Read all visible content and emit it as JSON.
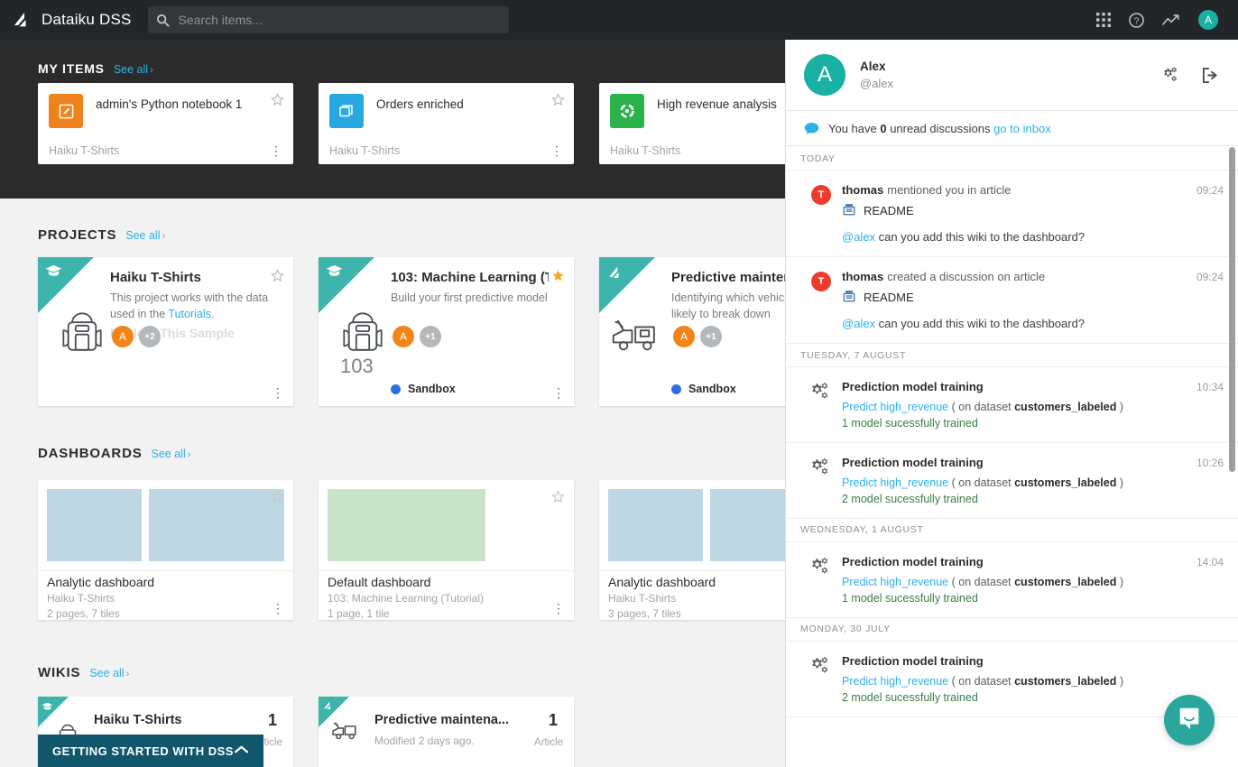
{
  "navbar": {
    "brand": "Dataiku DSS",
    "search_placeholder": "Search items...",
    "search_value": "",
    "icons": [
      "apps-grid-icon",
      "help-circle-icon",
      "trending-up-icon"
    ],
    "avatar_initial": "A"
  },
  "my_items": {
    "title": "MY ITEMS",
    "see_all": "See all",
    "chevron": "›",
    "cards": [
      {
        "name": "admin's Python notebook 1",
        "project": "Haiku T-Shirts",
        "icon": "notebook-edit-icon",
        "color": "#f0821e"
      },
      {
        "name": "Orders enriched",
        "project": "Haiku T-Shirts",
        "icon": "dataset-folder-icon",
        "color": "#28a8e0"
      },
      {
        "name": "High revenue analysis",
        "project": "Haiku T-Shirts",
        "icon": "analysis-circle-icon",
        "color": "#2ab24b"
      }
    ]
  },
  "projects": {
    "title": "PROJECTS",
    "see_all": "See all",
    "chevron": "›",
    "cards": [
      {
        "title": "Haiku T-Shirts",
        "desc_prefix": "This project works with the data used in the ",
        "desc_link": "Tutorials",
        "desc_suffix": ".",
        "ghost_text": "Explore This Sample",
        "number": "",
        "avatars": [
          {
            "label": "A",
            "type": "user"
          },
          {
            "label": "+2",
            "type": "more"
          }
        ],
        "status": "",
        "status_color": "",
        "starred": false,
        "bag_icon": "backpack-icon"
      },
      {
        "title": "103: Machine Learning (T...",
        "desc_prefix": "Build your first predictive model",
        "desc_link": "",
        "desc_suffix": "",
        "ghost_text": "",
        "number": "103",
        "avatars": [
          {
            "label": "A",
            "type": "user"
          },
          {
            "label": "+1",
            "type": "more"
          }
        ],
        "status": "Sandbox",
        "status_color": "#2f6fe0",
        "starred": true,
        "bag_icon": "backpack-icon"
      },
      {
        "title": "Predictive maintenance",
        "desc_prefix": "Identifying which vehicles are likely to break down",
        "desc_link": "",
        "desc_suffix": "",
        "ghost_text": "",
        "number": "",
        "avatars": [
          {
            "label": "A",
            "type": "user"
          },
          {
            "label": "+1",
            "type": "more"
          }
        ],
        "status": "Sandbox",
        "status_color": "#2f6fe0",
        "starred": false,
        "bag_icon": "tow-truck-icon"
      }
    ]
  },
  "dashboards": {
    "title": "DASHBOARDS",
    "see_all": "See all",
    "chevron": "›",
    "cards": [
      {
        "name": "Analytic dashboard",
        "project": "Haiku T-Shirts",
        "meta": "2 pages, 7 tiles",
        "thumb": "blue-two-tile"
      },
      {
        "name": "Default dashboard",
        "project": "103: Machine Learning (Tutorial)",
        "meta": "1 page, 1 tile",
        "thumb": "green-one-tile"
      },
      {
        "name": "Analytic dashboard",
        "project": "Haiku T-Shirts",
        "meta": "3 pages, 7 tiles",
        "thumb": "blue-two-tile"
      }
    ]
  },
  "wikis": {
    "title": "WIKIS",
    "see_all": "See all",
    "chevron": "›",
    "cards": [
      {
        "title": "Haiku T-Shirts",
        "sub": "",
        "count": "1",
        "unit": "Article",
        "icon": "backpack-icon"
      },
      {
        "title": "Predictive maintena...",
        "sub": "Modified 2 days ago.",
        "count": "1",
        "unit": "Article",
        "icon": "tow-truck-icon"
      }
    ]
  },
  "getting_started": {
    "label": "GETTING STARTED WITH DSS",
    "chevron": "^"
  },
  "panel": {
    "user": "Alex",
    "handle": "@alex",
    "settings_icon": "gears-settings-icon",
    "logout_icon": "logout-arrow-icon",
    "inbox": {
      "bubble_icon": "chat-bubble-icon",
      "prefix": "You have ",
      "count": "0",
      "suffix": " unread discussions ",
      "link": "go to inbox"
    },
    "groups": [
      {
        "day": "TODAY",
        "items": [
          {
            "icon": "avatar-thomas",
            "avatar_letter": "T",
            "actor": "thomas",
            "action": "mentioned you in article",
            "time": "09:24",
            "object_icon": "article-icon",
            "object": "README",
            "message_mention": "@alex",
            "message_rest": " can you add this wiki to the dashboard?",
            "type": "discussion"
          },
          {
            "icon": "avatar-thomas",
            "avatar_letter": "T",
            "actor": "thomas",
            "action": "created a discussion on article",
            "time": "09:24",
            "object_icon": "article-icon",
            "object": "README",
            "message_mention": "@alex",
            "message_rest": " can you add this wiki to the dashboard?",
            "type": "discussion"
          }
        ]
      },
      {
        "day": "TUESDAY, 7 AUGUST",
        "items": [
          {
            "icon": "gears-icon",
            "title": "Prediction model training",
            "time": "10:34",
            "detail_link": "Predict high_revenue",
            "detail_mid": " ( on dataset ",
            "detail_bold": "customers_labeled",
            "detail_end": " )",
            "result": "1 model sucessfully trained",
            "type": "training"
          },
          {
            "icon": "gears-icon",
            "title": "Prediction model training",
            "time": "10:26",
            "detail_link": "Predict high_revenue",
            "detail_mid": " ( on dataset ",
            "detail_bold": "customers_labeled",
            "detail_end": " )",
            "result": "2 model sucessfully trained",
            "type": "training"
          }
        ]
      },
      {
        "day": "WEDNESDAY, 1 AUGUST",
        "items": [
          {
            "icon": "gears-icon",
            "title": "Prediction model training",
            "time": "14:04",
            "detail_link": "Predict high_revenue",
            "detail_mid": " ( on dataset ",
            "detail_bold": "customers_labeled",
            "detail_end": " )",
            "result": "1 model sucessfully trained",
            "type": "training"
          }
        ]
      },
      {
        "day": "MONDAY, 30 JULY",
        "items": [
          {
            "icon": "gears-icon",
            "title": "Prediction model training",
            "time": "",
            "detail_link": "Predict high_revenue",
            "detail_mid": " ( on dataset ",
            "detail_bold": "customers_labeled",
            "detail_end": " )",
            "result": "2 model sucessfully trained",
            "type": "training"
          }
        ]
      }
    ]
  },
  "intercom": {
    "icon": "intercom-chat-icon",
    "color": "#2aa69c"
  },
  "colors": {
    "nav_bg": "#222629",
    "band_dark": "#2b2b2b",
    "page_bg": "#f2f2f2",
    "accent_link": "#2ab1e8",
    "teal": "#3db5ad",
    "brand_teal": "#19b1a3",
    "getting_started": "#11566b"
  }
}
